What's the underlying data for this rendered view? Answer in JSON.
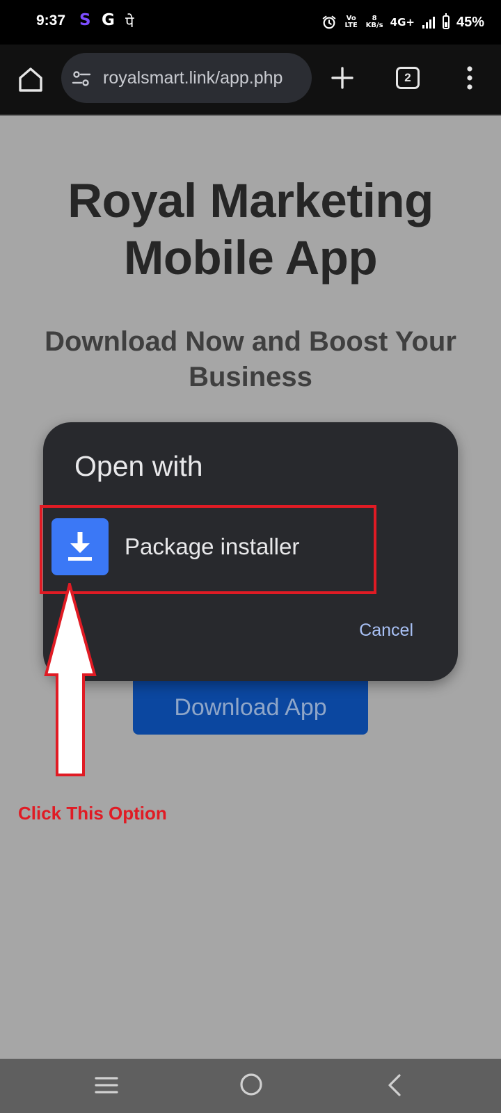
{
  "status_bar": {
    "time": "9:37",
    "app_icons": [
      "S",
      "G",
      "पे"
    ],
    "volte": "Vo LTE",
    "speed": "8",
    "speed_unit": "KB/s",
    "network": "4G+",
    "battery_percent": "45%"
  },
  "browser": {
    "url": "royalsmart.link/app.php",
    "tab_count": "2"
  },
  "page": {
    "title_line1": "Royal Marketing",
    "title_line2": "Mobile App",
    "subtitle": "Download Now and Boost Your Business",
    "download_button": "Download App"
  },
  "dialog": {
    "title": "Open with",
    "option_label": "Package installer",
    "cancel_label": "Cancel"
  },
  "annotation": {
    "text": "Click This Option",
    "color": "#e01b24"
  },
  "colors": {
    "dialog_bg": "#28292d",
    "installer_icon": "#3b78f6",
    "download_button": "#0b47a0",
    "page_overlay": "#a6a6a6"
  }
}
